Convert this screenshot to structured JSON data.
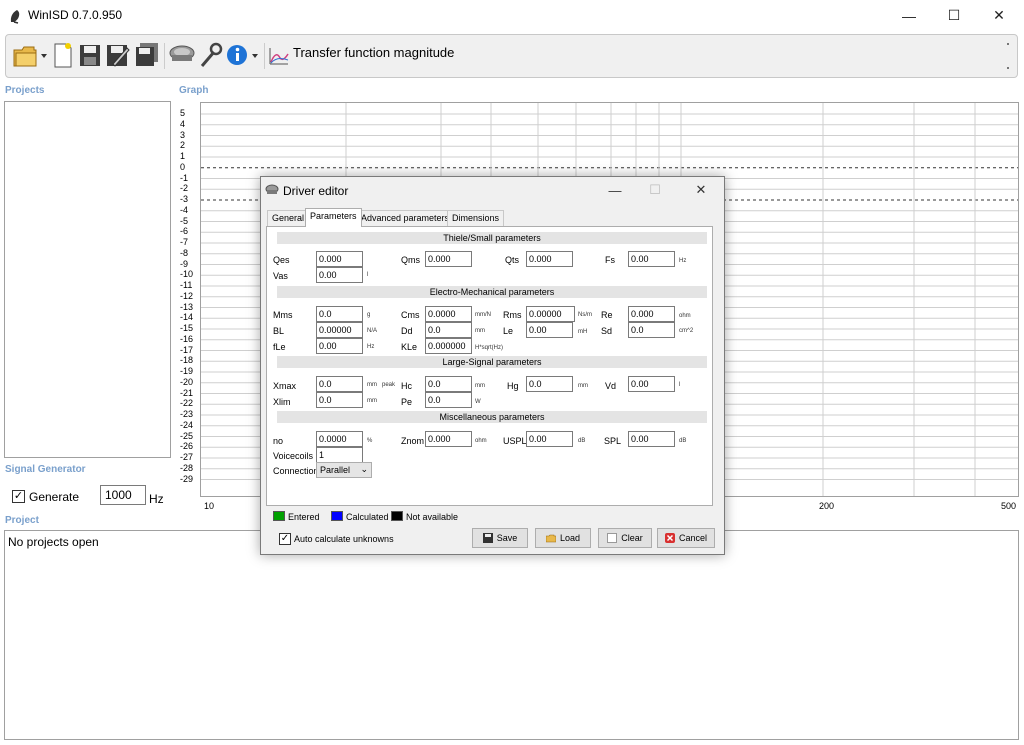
{
  "app": {
    "title": "WinISD 0.7.0.950"
  },
  "window_controls": {
    "minimize": "—",
    "maximize": "☐",
    "close": "✕"
  },
  "toolbar": {
    "transfer_function_label": "Transfer function magnitude",
    "icons": [
      "open-folder-icon",
      "new-document-icon",
      "save-icon",
      "save-as-icon",
      "save-all-icon",
      "driver-icon",
      "tools-icon",
      "info-icon",
      "chart-icon"
    ]
  },
  "sections": {
    "projects": "Projects",
    "graph": "Graph",
    "signal_generator": "Signal Generator",
    "project": "Project"
  },
  "graph": {
    "y_ticks": [
      "5",
      "4",
      "3",
      "2",
      "1",
      "0",
      "-1",
      "-2",
      "-3",
      "-4",
      "-5",
      "-6",
      "-7",
      "-8",
      "-9",
      "-10",
      "-11",
      "-12",
      "-13",
      "-14",
      "-15",
      "-16",
      "-17",
      "-18",
      "-19",
      "-20",
      "-21",
      "-22",
      "-23",
      "-24",
      "-25",
      "-26",
      "-27",
      "-28",
      "-29"
    ],
    "x_ticks": [
      "10",
      "200",
      "500"
    ]
  },
  "signal_generator": {
    "generate_label": "Generate",
    "generate_checked": true,
    "frequency_value": "1000",
    "unit": "Hz"
  },
  "project_panel": {
    "text": "No projects open"
  },
  "dialog": {
    "title": "Driver editor",
    "tabs": [
      "General",
      "Parameters",
      "Advanced parameters",
      "Dimensions"
    ],
    "active_tab": "Parameters",
    "groups": {
      "thiele_small": "Thiele/Small parameters",
      "electro_mechanical": "Electro-Mechanical parameters",
      "large_signal": "Large-Signal parameters",
      "misc": "Miscellaneous parameters"
    },
    "params": {
      "qes": {
        "label": "Qes",
        "value": "0.000"
      },
      "qms": {
        "label": "Qms",
        "value": "0.000"
      },
      "qts": {
        "label": "Qts",
        "value": "0.000"
      },
      "fs": {
        "label": "Fs",
        "value": "0.00",
        "unit": "Hz"
      },
      "vas": {
        "label": "Vas",
        "value": "0.00",
        "unit": "l"
      },
      "mms": {
        "label": "Mms",
        "value": "0.0",
        "unit": "g"
      },
      "cms": {
        "label": "Cms",
        "value": "0.0000",
        "unit": "mm/N"
      },
      "rms": {
        "label": "Rms",
        "value": "0.00000",
        "unit": "Ns/m"
      },
      "re": {
        "label": "Re",
        "value": "0.000",
        "unit": "ohm"
      },
      "bl": {
        "label": "BL",
        "value": "0.00000",
        "unit": "N/A"
      },
      "dd": {
        "label": "Dd",
        "value": "0.0",
        "unit": "mm"
      },
      "le": {
        "label": "Le",
        "value": "0.00",
        "unit": "mH"
      },
      "sd": {
        "label": "Sd",
        "value": "0.0",
        "unit": "cm^2"
      },
      "fle": {
        "label": "fLe",
        "value": "0.00",
        "unit": "Hz"
      },
      "kle": {
        "label": "KLe",
        "value": "0.000000",
        "unit": "H*sqrt(Hz)"
      },
      "xmax": {
        "label": "Xmax",
        "value": "0.0",
        "unit": "mm"
      },
      "hc": {
        "label": "Hc",
        "value": "0.0",
        "unit": "mm",
        "prefix": "peak"
      },
      "hg": {
        "label": "Hg",
        "value": "0.0",
        "unit": "mm"
      },
      "vd": {
        "label": "Vd",
        "value": "0.00",
        "unit": "l"
      },
      "xlim": {
        "label": "Xlim",
        "value": "0.0",
        "unit": "mm"
      },
      "pe": {
        "label": "Pe",
        "value": "0.0",
        "unit": "W"
      },
      "no": {
        "label": "no",
        "value": "0.0000",
        "unit": "%"
      },
      "znom": {
        "label": "Znom",
        "value": "0.000",
        "unit": "ohm"
      },
      "uspl": {
        "label": "USPL",
        "value": "0.00",
        "unit": "dB"
      },
      "spl": {
        "label": "SPL",
        "value": "0.00",
        "unit": "dB"
      },
      "voicecoils": {
        "label": "Voicecoils",
        "value": "1"
      },
      "connection": {
        "label": "Connection",
        "value": "Parallel"
      }
    },
    "legend": {
      "entered": {
        "label": "Entered",
        "color": "#00a000"
      },
      "calculated": {
        "label": "Calculated",
        "color": "#0000ff"
      },
      "not_available": {
        "label": "Not available",
        "color": "#000000"
      }
    },
    "auto_calc": {
      "label": "Auto calculate unknowns",
      "checked": true
    },
    "buttons": {
      "save": "Save",
      "load": "Load",
      "clear": "Clear",
      "cancel": "Cancel"
    }
  }
}
